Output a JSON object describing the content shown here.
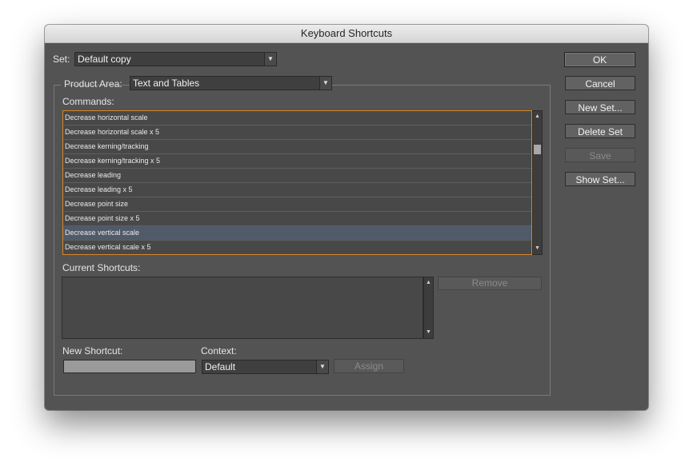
{
  "window": {
    "title": "Keyboard Shortcuts"
  },
  "set": {
    "label": "Set:",
    "value": "Default copy"
  },
  "product_area": {
    "label": "Product Area:",
    "value": "Text and Tables"
  },
  "commands": {
    "label": "Commands:",
    "items": [
      "Decrease horizontal scale",
      "Decrease horizontal scale x 5",
      "Decrease kerning/tracking",
      "Decrease kerning/tracking x 5",
      "Decrease leading",
      "Decrease leading x 5",
      "Decrease point size",
      "Decrease point size x 5",
      "Decrease vertical scale",
      "Decrease vertical scale x 5"
    ],
    "selected_item": "Decrease vertical scale"
  },
  "current_shortcuts": {
    "label": "Current Shortcuts:",
    "remove_label": "Remove"
  },
  "new_shortcut": {
    "label": "New Shortcut:",
    "value": ""
  },
  "context": {
    "label": "Context:",
    "value": "Default",
    "assign_label": "Assign"
  },
  "buttons": {
    "ok": "OK",
    "cancel": "Cancel",
    "new_set": "New Set...",
    "delete_set": "Delete Set",
    "save": "Save",
    "show_set": "Show Set..."
  },
  "icons": {
    "dropdown_arrow": "▼",
    "scroll_up": "▲",
    "scroll_down": "▼"
  },
  "colors": {
    "panel_bg": "#535353",
    "list_focus_border": "#d9862a",
    "selected_row": "#505a68"
  }
}
